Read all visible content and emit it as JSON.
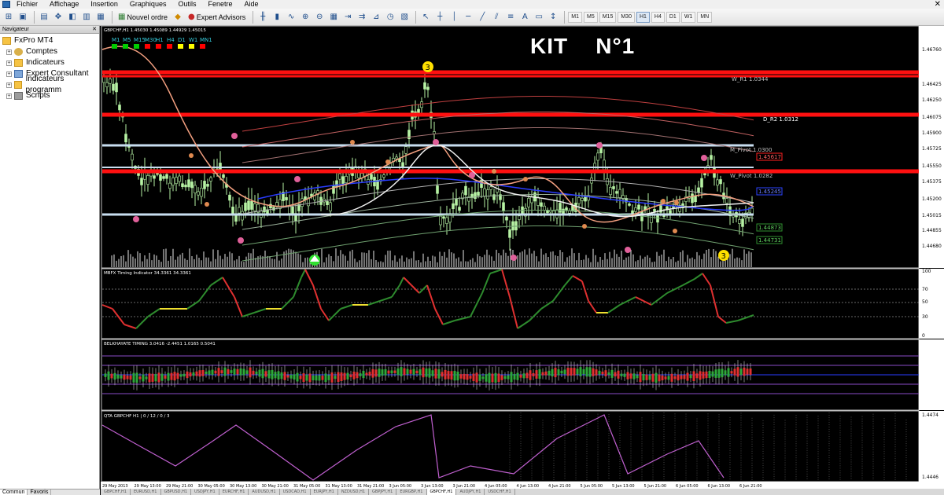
{
  "menubar": {
    "items": [
      "Fichier",
      "Affichage",
      "Insertion",
      "Graphiques",
      "Outils",
      "Fenetre",
      "Aide"
    ]
  },
  "toolbar": {
    "new_order": "Nouvel ordre",
    "expert_advisors": "Expert Advisors",
    "timeframes": [
      "M1",
      "M5",
      "M15",
      "M30",
      "H1",
      "H4",
      "D1",
      "W1",
      "MN"
    ],
    "active_timeframe": "H1"
  },
  "navigator": {
    "title": "Navigateur",
    "items": [
      {
        "label": "FxPro MT4",
        "icon": "folder-icon"
      },
      {
        "label": "Comptes",
        "icon": "accounts-icon"
      },
      {
        "label": "Indicateurs",
        "icon": "indicators-icon"
      },
      {
        "label": "Expert Consultant",
        "icon": "expert-icon"
      },
      {
        "label": "Indicateurs programm",
        "icon": "custom-indicators-icon"
      },
      {
        "label": "Scripts",
        "icon": "scripts-icon"
      }
    ],
    "bottom_tabs": [
      "Commun",
      "Favoris"
    ]
  },
  "chart": {
    "title": "KIT    N°1",
    "symbol_info": "GBPCHF,H1  1.45030 1.45089 1.44929 1.45015",
    "mtf_labels": [
      "M1",
      "M5",
      "M15",
      "M30",
      "H1",
      "H4",
      "D1",
      "W1",
      "MN1"
    ],
    "mtf_colors": [
      "#00cc00",
      "#00cc00",
      "#00cc00",
      "#ff0000",
      "#ff0000",
      "#ff0000",
      "#ffff00",
      "#ffff00",
      "#ff0000"
    ],
    "level_labels": [
      {
        "text": "W_R1  1.0344",
        "color": "#bfbfbf"
      },
      {
        "text": "D_R2  1.0312",
        "color": "#ffffff"
      },
      {
        "text": "M_Pivot  1.0300",
        "color": "#bfbfbf"
      },
      {
        "text": "W_Pivot  1.0282",
        "color": "#bfbfbf"
      }
    ],
    "price_tags": [
      {
        "text": "1.45617",
        "color": "#ff2020"
      },
      {
        "text": "1.45245",
        "color": "#2b45ff"
      },
      {
        "text": "1.44873",
        "color": "#2f8f2f"
      },
      {
        "text": "1.44731",
        "color": "#2f8f2f"
      }
    ],
    "price_scale": [
      "1.46760",
      "1.46425",
      "1.46250",
      "1.46075",
      "1.45900",
      "1.45725",
      "1.45550",
      "1.45375",
      "1.45200",
      "1.45015",
      "1.44855",
      "1.44680"
    ],
    "time_axis": [
      "29 May 2013",
      "29 May 13:00",
      "29 May 21:00",
      "30 May 05:00",
      "30 May 13:00",
      "30 May 21:00",
      "31 May 05:00",
      "31 May 13:00",
      "31 May 21:00",
      "3 Jun 05:00",
      "3 Jun 13:00",
      "3 Jun 21:00",
      "4 Jun 05:00",
      "4 Jun 13:00",
      "4 Jun 21:00",
      "5 Jun 05:00",
      "5 Jun 13:00",
      "5 Jun 21:00",
      "6 Jun 05:00",
      "6 Jun 13:00",
      "6 Jun 21:00"
    ],
    "markers": [
      "3",
      "3"
    ]
  },
  "subwindows": {
    "timing": {
      "label": "MBFX Timing Indicator 34.3361 34.3361",
      "scale": [
        "100",
        "70",
        "50",
        "30",
        "0"
      ]
    },
    "belkhayate": {
      "label": "BELKHAYATE TIMING  3.0416 -2.4451 1.0165 0.5041"
    },
    "qta": {
      "label": "QTA GBPCHF H1 | 0 / 12 / 0 / 3",
      "scale_top": "1.4474",
      "scale_bottom": "1.4446"
    }
  },
  "chart_tabs": [
    "GBPCHF,H1",
    "EURUSD,H1",
    "GBPUSD,H1",
    "USDJPY,H1",
    "EURCHF,H1",
    "AUDUSD,H1",
    "USDCAD,H1",
    "EURJPY,H1",
    "NZDUSD,H1",
    "GBPJPY,H1",
    "EURGBP,H1",
    "GBPCHF,H1",
    "AUDJPY,H1",
    "USDCHF,H1"
  ]
}
